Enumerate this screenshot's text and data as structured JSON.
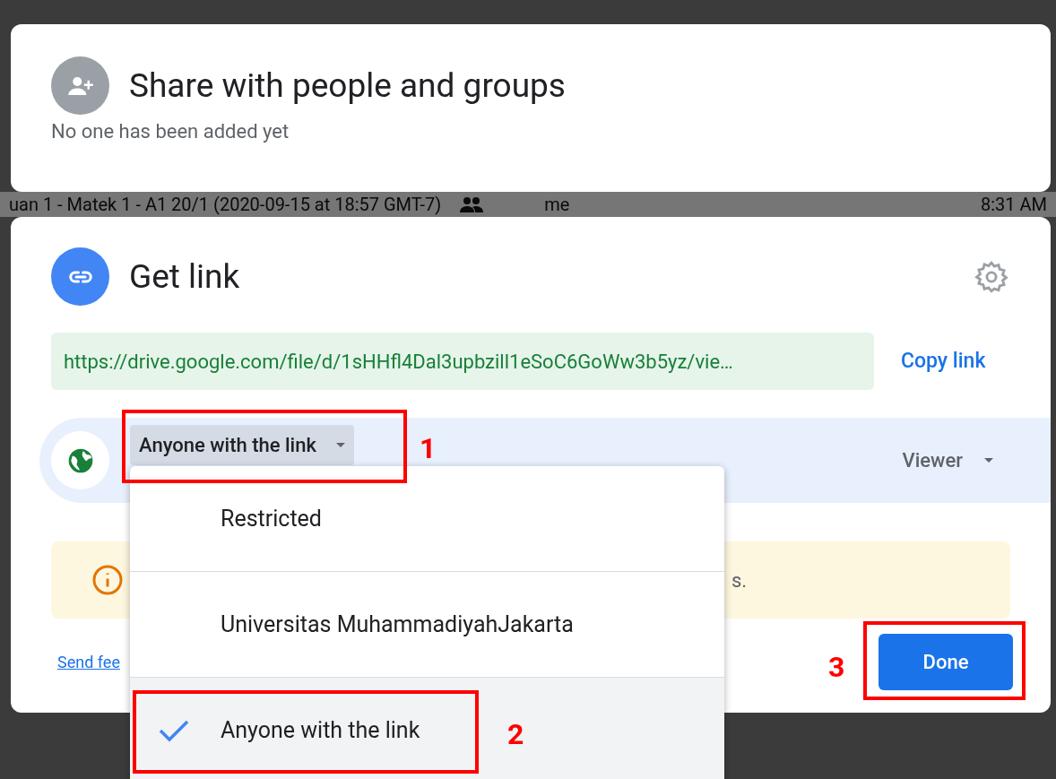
{
  "share_card": {
    "title": "Share with people and groups",
    "subtitle": "No one has been added yet"
  },
  "background_row": {
    "file_name": "uan 1 - Matek 1 - A1 20/1 (2020-09-15 at 18:57 GMT-7)",
    "owner": "me",
    "time": "8:31 AM"
  },
  "link_card": {
    "title": "Get link",
    "url": "https://drive.google.com/file/d/1sHHfl4Dal3upbzill1eSoC6GoWw3b5yz/vie…",
    "copy_button": "Copy link",
    "access_dropdown": "Anyone with the link",
    "role_dropdown": "Viewer",
    "warning_visible_text": "s.",
    "feedback_link": "Send fee",
    "done_button": "Done"
  },
  "access_menu": [
    {
      "label": "Restricted",
      "selected": false
    },
    {
      "label": "Universitas MuhammadiyahJakarta",
      "selected": false
    },
    {
      "label": "Anyone with the link",
      "selected": true
    }
  ],
  "annotations": [
    {
      "kind": "dropdown",
      "label": "1"
    },
    {
      "kind": "option",
      "label": "2"
    },
    {
      "kind": "done",
      "label": "3"
    }
  ]
}
